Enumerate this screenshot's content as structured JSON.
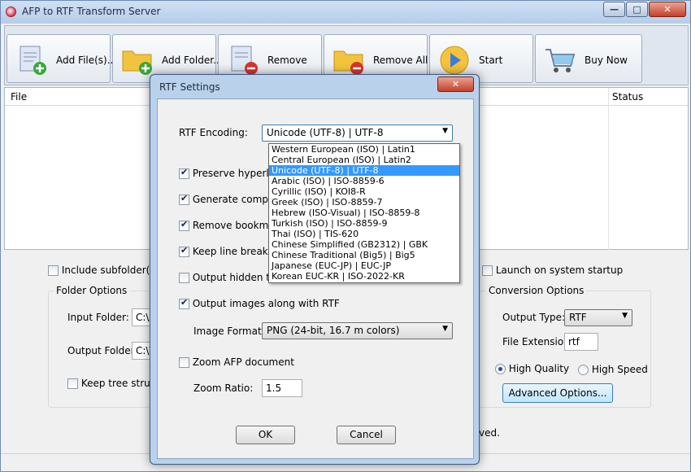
{
  "window": {
    "title": "AFP to RTF Transform Server",
    "controls": {
      "minimize": "—",
      "maximize": "□",
      "close": "✕"
    }
  },
  "toolbar": {
    "buttons": [
      {
        "label": "Add File(s)...",
        "icon": "add-file-icon"
      },
      {
        "label": "Add Folder...",
        "icon": "add-folder-icon"
      },
      {
        "label": "Remove",
        "icon": "remove-file-icon"
      },
      {
        "label": "Remove All",
        "icon": "remove-folder-icon"
      },
      {
        "label": "Start",
        "icon": "play-icon"
      },
      {
        "label": "Buy Now",
        "icon": "cart-icon"
      }
    ]
  },
  "file_list": {
    "columns": [
      "File",
      "Status"
    ]
  },
  "options": {
    "include_subfolders": "Include subfolder(s)",
    "launch_on_startup": "Launch on system startup",
    "folder_options": {
      "title": "Folder Options",
      "input_label": "Input Folder:",
      "input_value": "C:\\A",
      "output_label": "Output Folder:",
      "output_value": "C:\\T",
      "keep_tree": "Keep tree structure"
    },
    "conversion_options": {
      "title": "Conversion Options",
      "output_type_label": "Output Type:",
      "output_type_value": "RTF",
      "file_ext_label": "File Extension:",
      "file_ext_value": "rtf",
      "high_quality": "High Quality",
      "high_speed": "High Speed",
      "advanced_button": "Advanced Options..."
    },
    "status_fragment": "ved."
  },
  "dialog": {
    "title": "RTF Settings",
    "close": "✕",
    "encoding_label": "RTF Encoding:",
    "encoding_value": "Unicode (UTF-8) | UTF-8",
    "encoding_options": [
      "Western European (ISO) | Latin1",
      "Central European (ISO) | Latin2",
      "Unicode (UTF-8) | UTF-8",
      "Arabic (ISO) | ISO-8859-6",
      "Cyrillic (ISO) | KOI8-R",
      "Greek (ISO) | ISO-8859-7",
      "Hebrew (ISO-Visual) | ISO-8859-8",
      "Turkish (ISO) | ISO-8859-9",
      "Thai (ISO) | TIS-620",
      "Chinese Simplified (GB2312) | GBK",
      "Chinese Traditional (Big5) | Big5",
      "Japanese (EUC-JP) | EUC-JP",
      "Korean EUC-KR | ISO-2022-KR"
    ],
    "selected_index": 2,
    "checkboxes": [
      {
        "label": "Preserve hyperlink",
        "checked": true
      },
      {
        "label": "Generate complex",
        "checked": true
      },
      {
        "label": "Remove bookmar",
        "checked": true
      },
      {
        "label": "Keep line breaks b",
        "checked": true
      },
      {
        "label": "Output hidden text",
        "checked": false
      },
      {
        "label": "Output images along with RTF",
        "checked": true
      }
    ],
    "image_format_label": "Image Format:",
    "image_format_value": "PNG (24-bit, 16.7 m colors)",
    "zoom_afp_label": "Zoom AFP document",
    "zoom_ratio_label": "Zoom Ratio:",
    "zoom_ratio_value": "1.5",
    "ok": "OK",
    "cancel": "Cancel"
  }
}
